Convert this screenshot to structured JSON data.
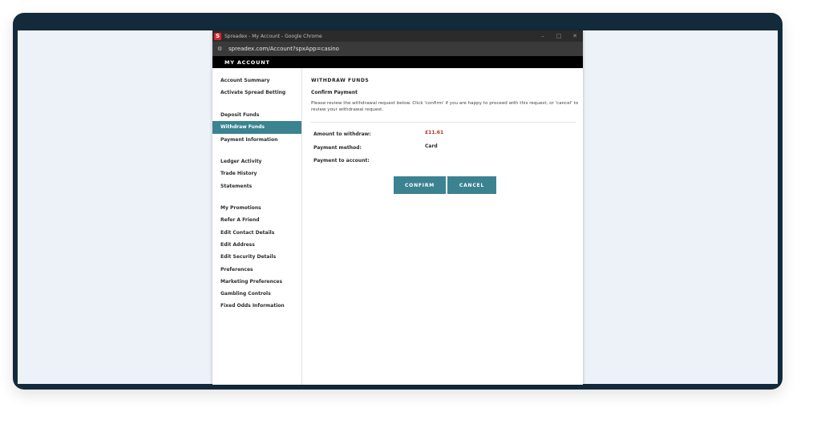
{
  "window": {
    "title": "Spreadex - My Account - Google Chrome",
    "favicon_letter": "S",
    "controls": [
      "–",
      "□",
      "✕"
    ]
  },
  "address_bar": {
    "url": "spreadex.com/Account?spxApp=casino"
  },
  "account_header": {
    "title": "MY ACCOUNT"
  },
  "sidebar": {
    "items": [
      {
        "label": "Account Summary"
      },
      {
        "label": "Activate Spread Betting"
      },
      {
        "label": "Deposit Funds"
      },
      {
        "label": "Withdraw Funds",
        "active": true
      },
      {
        "label": "Payment Information"
      },
      {
        "label": "Ledger Activity"
      },
      {
        "label": "Trade History"
      },
      {
        "label": "Statements"
      },
      {
        "label": "My Promotions"
      },
      {
        "label": "Refer A Friend"
      },
      {
        "label": "Edit Contact Details"
      },
      {
        "label": "Edit Address"
      },
      {
        "label": "Edit Security Details"
      },
      {
        "label": "Preferences"
      },
      {
        "label": "Marketing Preferences"
      },
      {
        "label": "Gambling Controls"
      },
      {
        "label": "Fixed Odds Information"
      }
    ]
  },
  "main": {
    "heading": "WITHDRAW FUNDS",
    "subheading": "Confirm Payment",
    "instructions": "Please review the withdrawal request below. Click 'confirm' if you are happy to proceed with this request, or 'cancel' to review your withdrawal request.",
    "amount_label": "Amount to withdraw:",
    "amount_value": "£11.61",
    "method_label": "Payment method:",
    "method_value": "Card",
    "account_label": "Payment to account:",
    "confirm_label": "CONFIRM",
    "cancel_label": "CANCEL"
  },
  "colors": {
    "accent": "#3b8391",
    "amount": "#b2332b",
    "frame": "#132a3b",
    "backdrop": "#edf2f8"
  }
}
